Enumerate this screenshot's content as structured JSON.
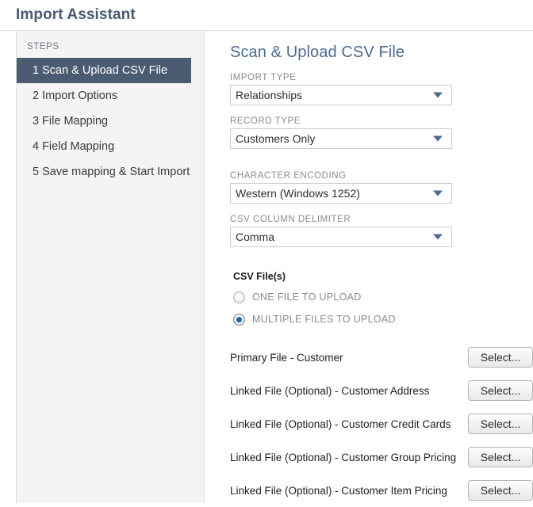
{
  "header": {
    "title": "Import Assistant"
  },
  "sidebar": {
    "heading": "STEPS",
    "items": [
      {
        "num": "1",
        "label": "Scan & Upload CSV File",
        "active": true
      },
      {
        "num": "2",
        "label": "Import Options",
        "active": false
      },
      {
        "num": "3",
        "label": "File Mapping",
        "active": false
      },
      {
        "num": "4",
        "label": "Field Mapping",
        "active": false
      },
      {
        "num": "5",
        "label": "Save mapping & Start Import",
        "active": false
      }
    ]
  },
  "main": {
    "title": "Scan & Upload CSV File",
    "fields": [
      {
        "label": "IMPORT TYPE",
        "value": "Relationships"
      },
      {
        "label": "RECORD TYPE",
        "value": "Customers Only"
      },
      {
        "label": "CHARACTER ENCODING",
        "value": "Western (Windows 1252)"
      },
      {
        "label": "CSV COLUMN DELIMITER",
        "value": "Comma"
      }
    ],
    "csv_files": {
      "label": "CSV File(s)",
      "options": [
        {
          "label": "ONE FILE TO UPLOAD",
          "checked": false
        },
        {
          "label": "MULTIPLE FILES TO UPLOAD",
          "checked": true
        }
      ]
    },
    "file_rows": [
      {
        "label": "Primary File - Customer",
        "button": "Select..."
      },
      {
        "label": "Linked File (Optional) - Customer Address",
        "button": "Select..."
      },
      {
        "label": "Linked File (Optional) - Customer Credit Cards",
        "button": "Select..."
      },
      {
        "label": "Linked File (Optional) - Customer Group Pricing",
        "button": "Select..."
      },
      {
        "label": "Linked File (Optional) - Customer Item Pricing",
        "button": "Select..."
      }
    ]
  },
  "colors": {
    "accent": "#4b5c72",
    "panel_title": "#4a6a90",
    "radio_selected": "#1a6aa8"
  }
}
